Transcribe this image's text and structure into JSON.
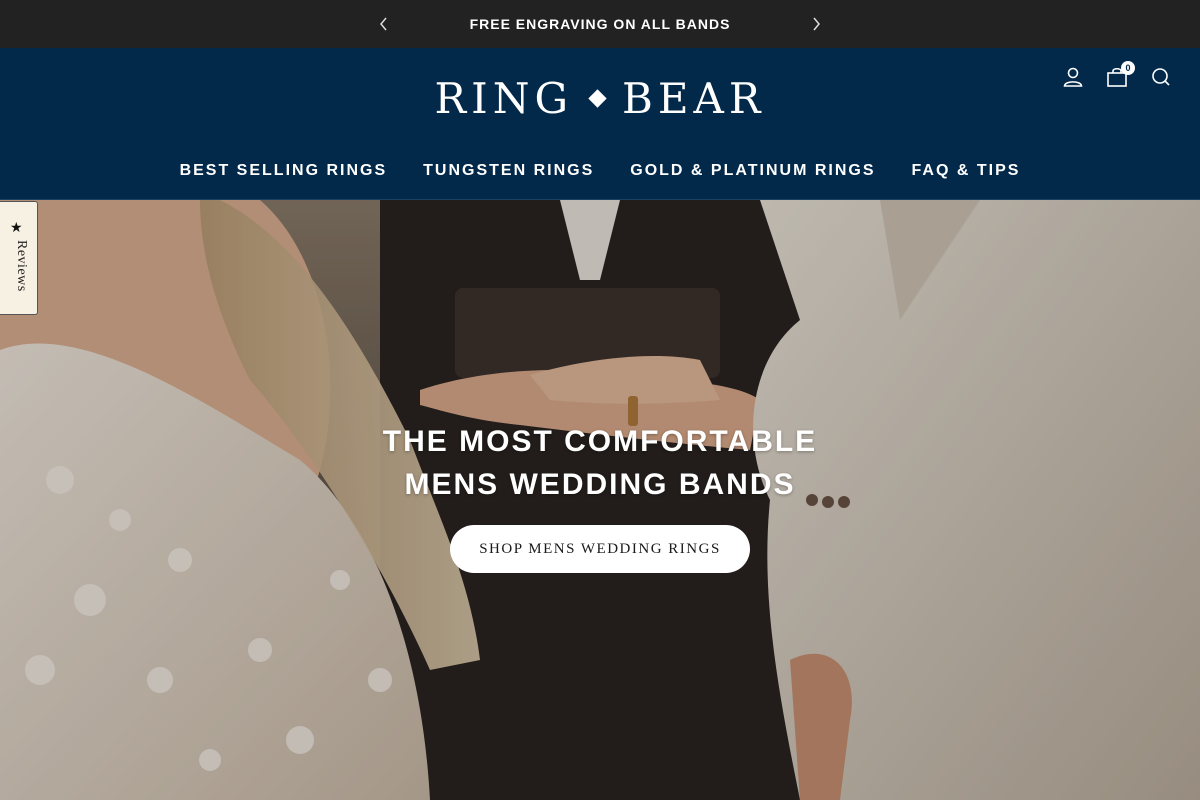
{
  "announcement": {
    "text": "FREE ENGRAVING ON ALL BANDS",
    "prev_icon": "chevron-left-icon",
    "next_icon": "chevron-right-icon"
  },
  "header": {
    "logo": {
      "left": "RING",
      "right": "BEAR",
      "separator_icon": "diamond-icon"
    },
    "icons": {
      "account": "account-icon",
      "cart": "cart-icon",
      "search": "search-icon"
    },
    "cart_count": "0",
    "nav": [
      {
        "label": "BEST SELLING RINGS"
      },
      {
        "label": "TUNGSTEN RINGS"
      },
      {
        "label": "GOLD & PLATINUM RINGS"
      },
      {
        "label": "FAQ & TIPS"
      }
    ]
  },
  "hero": {
    "title_line1": "THE MOST COMFORTABLE",
    "title_line2": "MENS WEDDING BANDS",
    "cta": "SHOP MENS WEDDING RINGS"
  },
  "reviews_tab": {
    "label": "Reviews",
    "icon": "star-icon"
  },
  "colors": {
    "announcement_bg": "#222222",
    "header_bg": "#02284a",
    "text_light": "#ffffff",
    "cta_bg": "#ffffff",
    "reviews_bg": "#f7f1e4"
  }
}
